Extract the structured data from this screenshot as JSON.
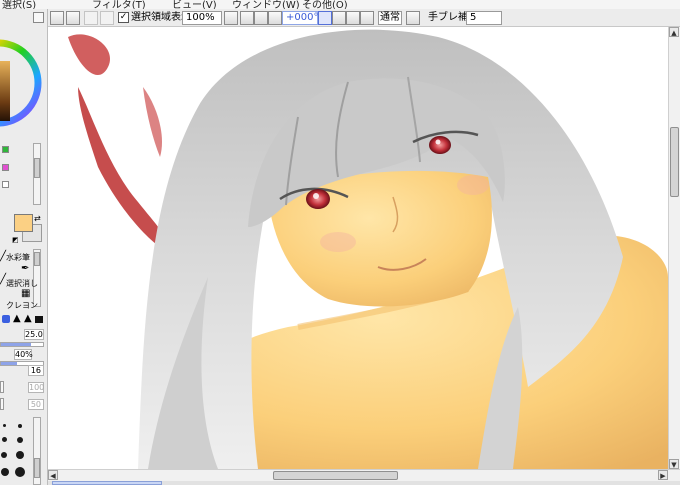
{
  "menu": {
    "items": [
      "選択(S)",
      "フィルタ(T)",
      "ビュー(V)",
      "ウィンドウ(W)",
      "その他(O)"
    ]
  },
  "toolbar": {
    "show_selection_label": "選択領域表示",
    "show_selection_checked": "✓",
    "zoom_value": "100%",
    "rotation_value": "+000°",
    "blend_mode": "通常",
    "stabilizer_label": "手ブレ補正",
    "stabilizer_value": "5"
  },
  "left_panel": {
    "tool_watercolor": "水彩筆",
    "tool_select_erase": "選択消し",
    "tool_crayon": "クレヨン",
    "size_value": "25.0",
    "opacity_value": "40%",
    "min_size_value": "16",
    "param_a_value": "100",
    "param_b_value": "50"
  },
  "colors": {
    "accent": "#3a5bd8",
    "foreground_color": "#fbd084",
    "background_color": "#e4e4e4"
  }
}
